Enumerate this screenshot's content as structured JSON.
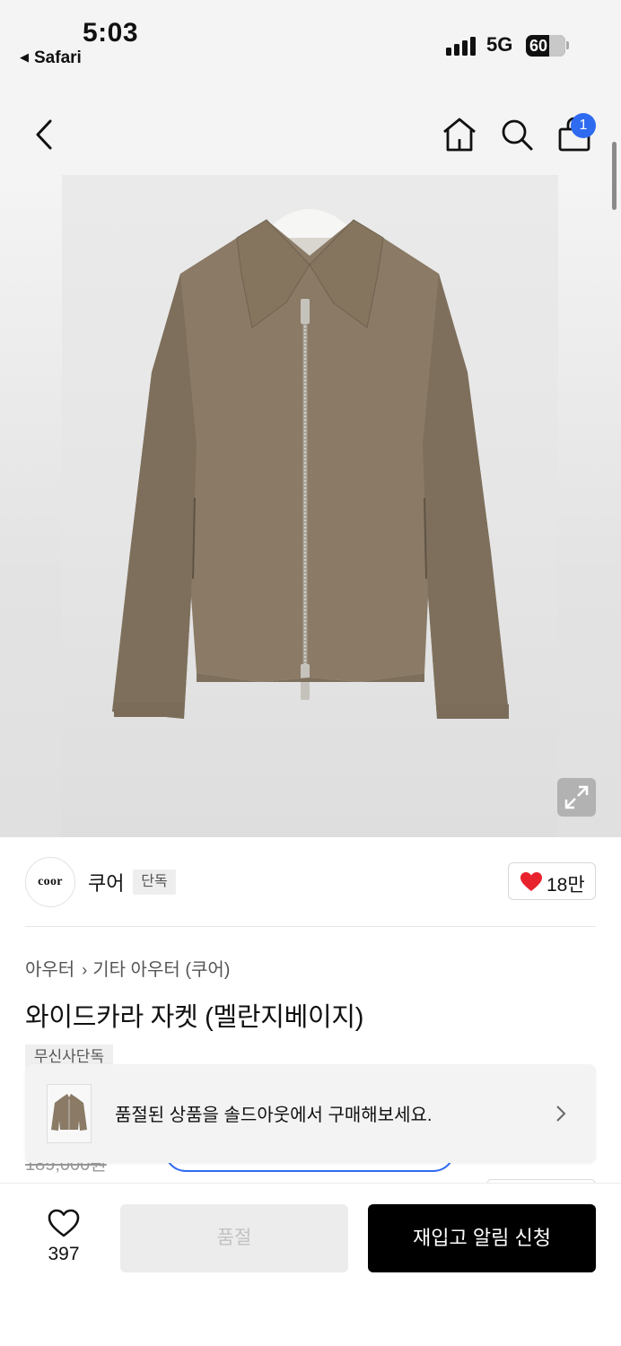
{
  "status_bar": {
    "time": "5:03",
    "back_app": "Safari",
    "network": "5G",
    "battery": "60"
  },
  "nav": {
    "cart_count": "1"
  },
  "brand": {
    "logo_text": "coor",
    "name": "쿠어",
    "tag": "단독",
    "like_count": "18만"
  },
  "breadcrumb": {
    "category": "아우터",
    "subcategory": "기타 아우터 (쿠어)"
  },
  "product": {
    "title": "와이드카라 자켓 (멜란지베이지)",
    "exclusive_tag": "무신사단독",
    "original_price": "189,000원"
  },
  "toast": {
    "message": "품절된 상품을 솔드아웃에서 구매해보세요."
  },
  "bottom_bar": {
    "wish_count": "397",
    "soldout_label": "품절",
    "restock_label": "재입고 알림 신청"
  },
  "colors": {
    "accent_blue": "#2f6bf0",
    "heart_red": "#e8232e",
    "jacket": "#8a7a66"
  }
}
